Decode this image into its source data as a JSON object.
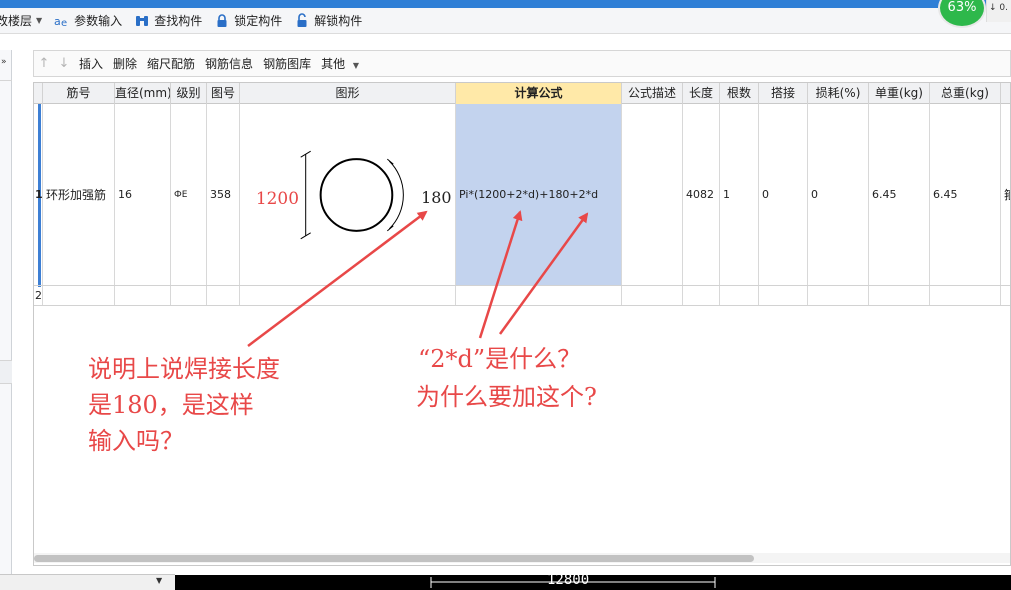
{
  "toolbar": {
    "items": [
      {
        "label": "改楼层"
      },
      {
        "label": "参数输入"
      },
      {
        "label": "查找构件"
      },
      {
        "label": "锁定构件"
      },
      {
        "label": "解锁构件"
      }
    ],
    "badge_percent": "63%",
    "speed": "0."
  },
  "subtoolbar": {
    "insert": "插入",
    "delete": "删除",
    "scale": "缩尺配筋",
    "info": "钢筋信息",
    "library": "钢筋图库",
    "other": "其他"
  },
  "grid": {
    "headers": [
      "筋号",
      "直径(mm)",
      "级别",
      "图号",
      "图形",
      "计算公式",
      "公式描述",
      "长度",
      "根数",
      "搭接",
      "损耗(%)",
      "单重(kg)",
      "总重(kg)"
    ],
    "active_header": "计算公式",
    "rows": [
      {
        "num": "1",
        "name": "环形加强筋",
        "diameter": "16",
        "grade": "ФE",
        "figure_no": "358",
        "shape": {
          "dim_left": "1200",
          "dim_right": "180"
        },
        "formula": "Pi*(1200+2*d)+180+2*d",
        "desc": "",
        "length": "4082",
        "count": "1",
        "lap": "0",
        "loss": "0",
        "unit_weight": "6.45",
        "total_weight": "6.45",
        "extra": "箍"
      },
      {
        "num": "2"
      }
    ]
  },
  "annotations": {
    "left_line1": "说明上说焊接长度",
    "left_line2": "是180，是这样",
    "left_line3": "输入吗？",
    "right_line1": "“2*d”是什么？",
    "right_line2": "为什么要加这个?"
  },
  "footer": {
    "dimension": "12800"
  },
  "colors": {
    "accent": "#2f7fd6",
    "selection": "#c3d3ee",
    "annotation": "#e84848",
    "active_header": "#ffe9a8"
  }
}
